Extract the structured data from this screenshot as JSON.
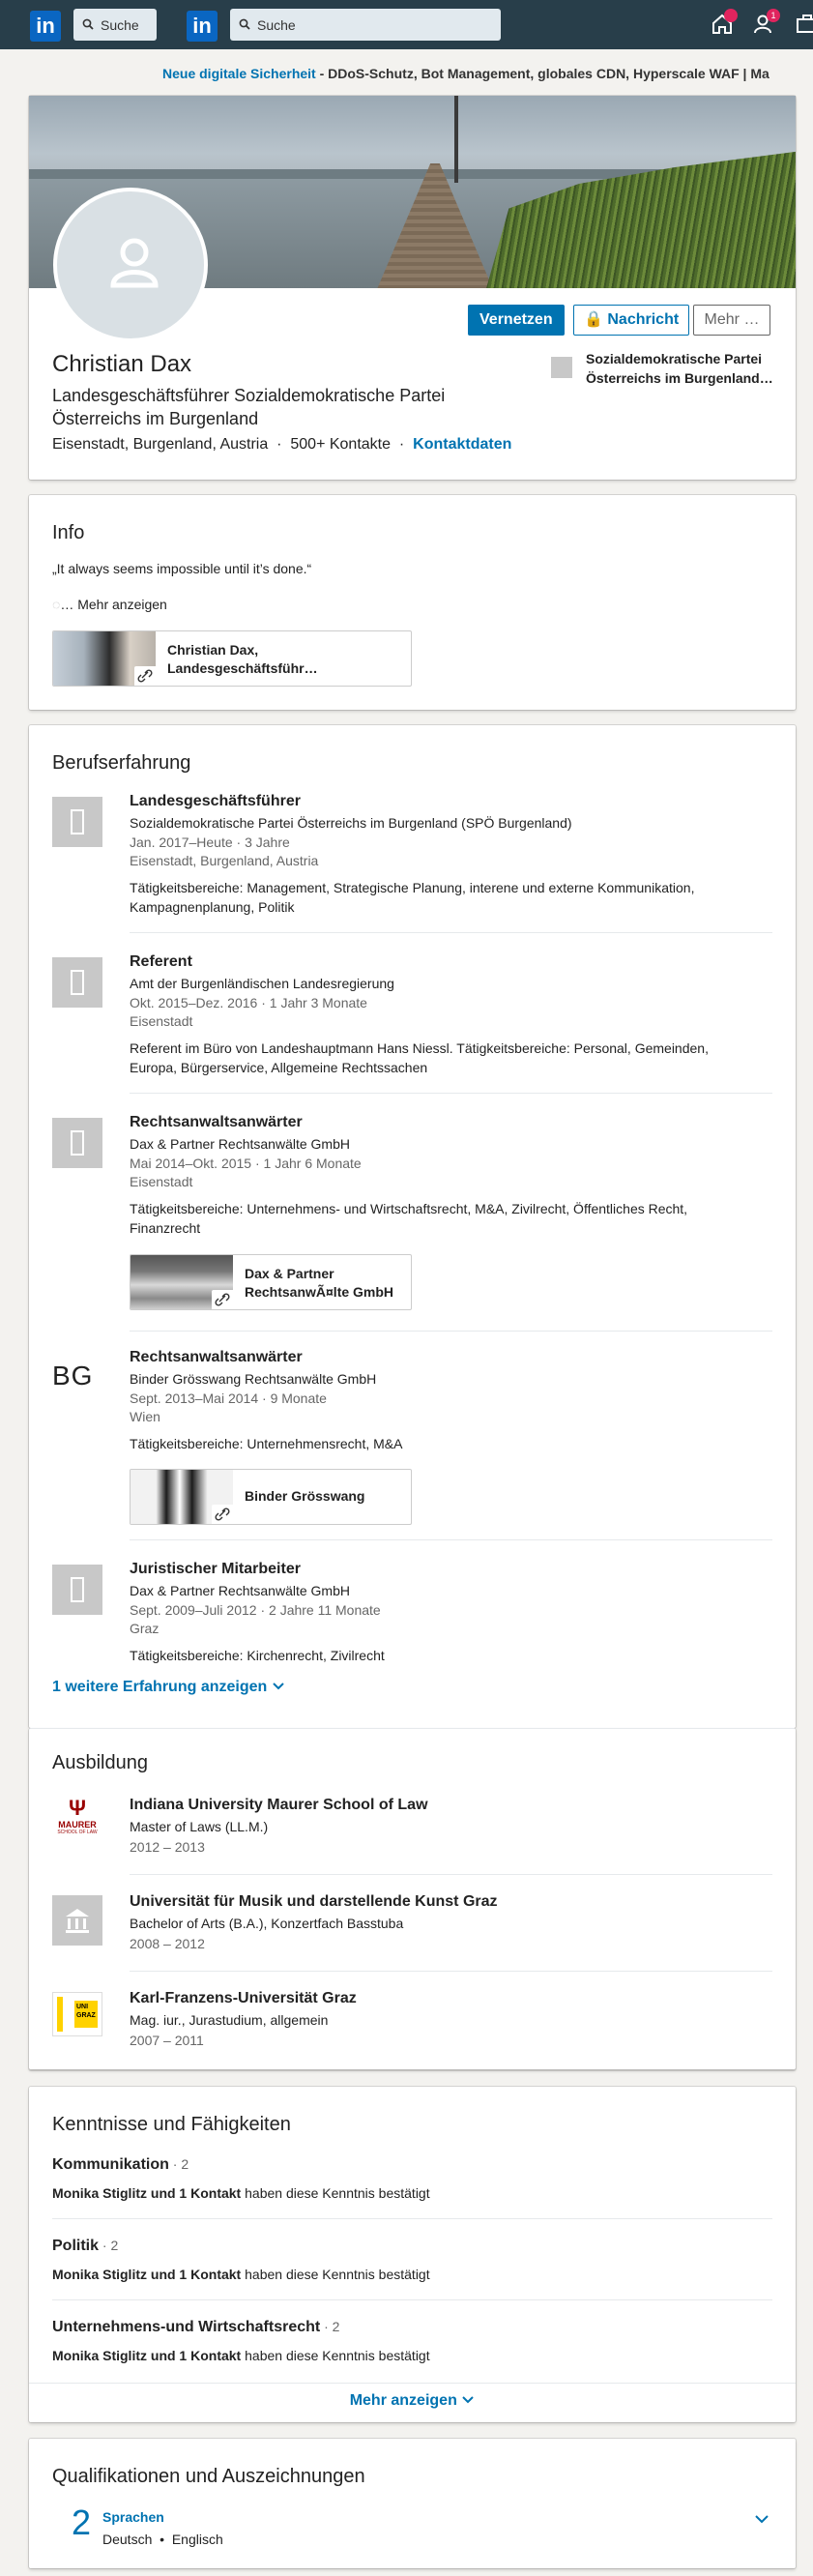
{
  "nav": {
    "search1_placeholder": "Suche",
    "search2_placeholder": "Suche",
    "notifications_badge": "",
    "network_badge": "1"
  },
  "promo": {
    "link": "Neue digitale Sicherheit",
    "text": " - DDoS-Schutz, Bot Management, globales CDN, Hyperscale WAF | Ma"
  },
  "profile": {
    "connect_label": "Vernetzen",
    "message_label": "Nachricht",
    "more_label": "Mehr …",
    "name": "Christian Dax",
    "headline": "Landesgeschäftsführer Sozialdemokratische Partei Österreichs im Burgenland",
    "location": "Eisenstadt, Burgenland, Austria",
    "connections": "500+ Kontakte",
    "contact_info": "Kontaktdaten",
    "current_company": "Sozialdemokratische Partei Österreichs im Burgenland…"
  },
  "info": {
    "heading": "Info",
    "quote": "„It always seems impossible until it’s done.“",
    "more": "… Mehr anzeigen",
    "media_title": "Christian Dax, Landesgeschäftsführ…"
  },
  "experience": {
    "heading": "Berufserfahrung",
    "items": [
      {
        "title": "Landesgeschäftsführer",
        "company": "Sozialdemokratische Partei Österreichs im Burgenland (SPÖ Burgenland)",
        "dates": "Jan. 2017–Heute",
        "duration": "3 Jahre",
        "location": "Eisenstadt, Burgenland, Austria",
        "description": "Tätigkeitsbereiche: Management, Strategische Planung, interene und externe Kommunikation, Kampagnenplanung, Politik"
      },
      {
        "title": "Referent",
        "company": "Amt der Burgenländischen Landesregierung",
        "dates": "Okt. 2015–Dez. 2016",
        "duration": "1 Jahr 3 Monate",
        "location": "Eisenstadt",
        "description": "Referent im Büro von Landeshauptmann Hans Niessl. Tätigkeitsbereiche: Personal, Gemeinden, Europa, Bürgerservice, Allgemeine Rechtssachen"
      },
      {
        "title": "Rechtsanwaltsanwärter",
        "company": "Dax & Partner Rechtsanwälte GmbH",
        "dates": "Mai 2014–Okt. 2015",
        "duration": "1 Jahr 6 Monate",
        "location": "Eisenstadt",
        "description": "Tätigkeitsbereiche: Unternehmens- und Wirtschaftsrecht, M&A, Zivilrecht, Öffentliches Recht, Finanzrecht",
        "media": "Dax & Partner RechtsanwÃ¤lte GmbH"
      },
      {
        "title": "Rechtsanwaltsanwärter",
        "company": "Binder Grösswang Rechtsanwälte GmbH",
        "dates": "Sept. 2013–Mai 2014",
        "duration": "9 Monate",
        "location": "Wien",
        "description": "Tätigkeitsbereiche: Unternehmensrecht, M&A",
        "media": "Binder Grösswang",
        "logo_text": "BG"
      },
      {
        "title": "Juristischer Mitarbeiter",
        "company": "Dax & Partner Rechtsanwälte GmbH",
        "dates": "Sept. 2009–Juli 2012",
        "duration": "2 Jahre 11 Monate",
        "location": "Graz",
        "description": "Tätigkeitsbereiche: Kirchenrecht, Zivilrecht"
      }
    ],
    "show_more": "1 weitere Erfahrung anzeigen"
  },
  "education": {
    "heading": "Ausbildung",
    "items": [
      {
        "school": "Indiana University Maurer School of Law",
        "degree": "Master of Laws (LL.M.)",
        "years": "2012 – 2013",
        "logo_text": "MAURER",
        "logo_sub": "SCHOOL OF LAW"
      },
      {
        "school": "Universität für Musik und darstellende Kunst Graz",
        "degree": "Bachelor of Arts (B.A.), Konzertfach Basstuba",
        "years": "2008 – 2012"
      },
      {
        "school": "Karl-Franzens-Universität Graz",
        "degree": "Mag. iur., Jurastudium, allgemein",
        "years": "2007 – 2011",
        "logo_text": "UNI GRAZ"
      }
    ]
  },
  "skills": {
    "heading": "Kenntnisse und Fähigkeiten",
    "items": [
      {
        "name": "Kommunikation",
        "count": " · 2",
        "endorsers": "Monika Stiglitz und 1 Kontakt",
        "suffix": " haben diese Kenntnis bestätigt"
      },
      {
        "name": "Politik",
        "count": " · 2",
        "endorsers": "Monika Stiglitz und 1 Kontakt",
        "suffix": " haben diese Kenntnis bestätigt"
      },
      {
        "name": "Unternehmens-und Wirtschaftsrecht",
        "count": " · 2",
        "endorsers": "Monika Stiglitz und 1 Kontakt",
        "suffix": " haben diese Kenntnis bestätigt"
      }
    ],
    "show_more": "Mehr anzeigen"
  },
  "accomplishments": {
    "heading": "Qualifikationen und Auszeichnungen",
    "count": "2",
    "label": "Sprachen",
    "languages": "Deutsch  •  Englisch"
  },
  "colors": {
    "accent": "#0073b1",
    "nav_bg": "#283e4a",
    "page_bg": "#f3f2ef"
  }
}
